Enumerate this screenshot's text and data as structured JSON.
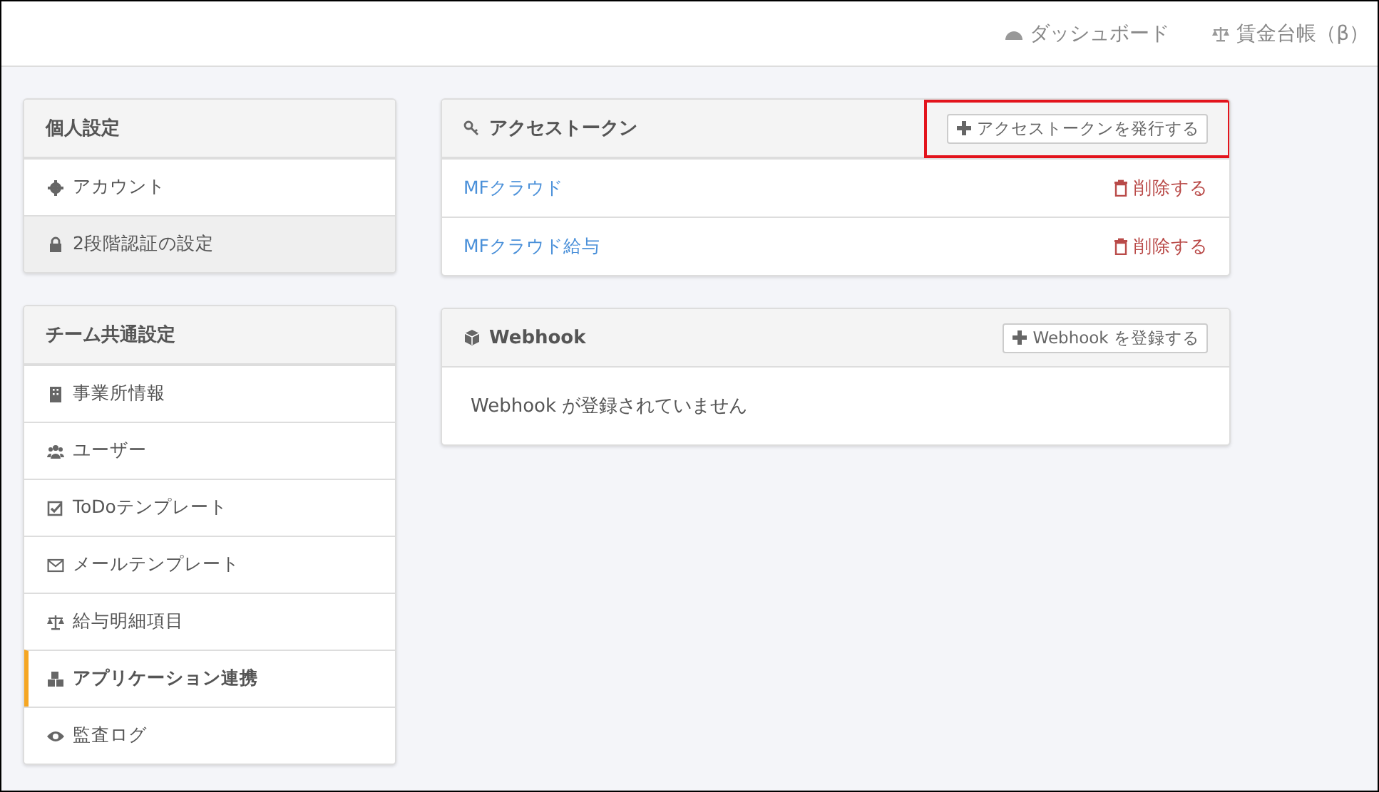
{
  "top_nav": [
    {
      "label": "ダッシュボード"
    },
    {
      "label": "賃金台帳（β）"
    }
  ],
  "sidebar": [
    {
      "title": "個人設定",
      "items": [
        {
          "label": "アカウント",
          "selected": false,
          "highlighted": false
        },
        {
          "label": "2段階認証の設定",
          "selected": false,
          "highlighted": true
        }
      ]
    },
    {
      "title": "チーム共通設定",
      "items": [
        {
          "label": "事業所情報",
          "selected": false,
          "highlighted": false
        },
        {
          "label": "ユーザー",
          "selected": false,
          "highlighted": false
        },
        {
          "label": "ToDoテンプレート",
          "selected": false,
          "highlighted": false
        },
        {
          "label": "メールテンプレート",
          "selected": false,
          "highlighted": false
        },
        {
          "label": "給与明細項目",
          "selected": false,
          "highlighted": false
        },
        {
          "label": "アプリケーション連携",
          "selected": true,
          "highlighted": false
        },
        {
          "label": "監査ログ",
          "selected": false,
          "highlighted": false
        }
      ]
    }
  ],
  "access_tokens": {
    "title": "アクセストークン",
    "add_button": {
      "label": "アクセストークンを発行する",
      "annotated": true
    },
    "rows": [
      {
        "name": "MFクラウド",
        "action": "削除する"
      },
      {
        "name": "MFクラウド給与",
        "action": "削除する"
      }
    ]
  },
  "webhook": {
    "title": "Webhook",
    "add_button": {
      "label": "Webhook を登録する",
      "annotated": false
    },
    "empty_message": "Webhook が登録されていません"
  }
}
